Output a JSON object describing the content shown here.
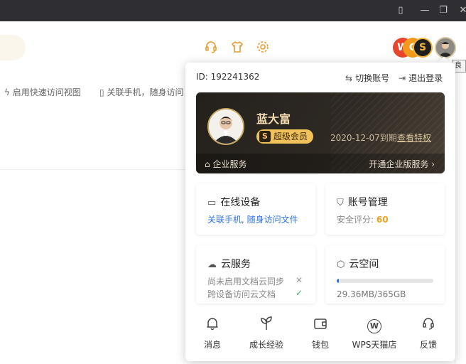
{
  "header": {
    "brand_badges": [
      "W",
      "C",
      "S"
    ],
    "tooltip_stub": "良"
  },
  "background": {
    "link_quick_access": "启用快速访问视图",
    "link_phone": "关联手机，随身访问"
  },
  "account": {
    "id_text": "ID: 192241362",
    "switch_account": "切换账号",
    "logout": "退出登录"
  },
  "member": {
    "name": "蓝大富",
    "vip_label": "超级会员",
    "vip_icon": "S",
    "expire": "2020-12-07到期",
    "view_perks": "查看特权",
    "enterprise_service": "企业服务",
    "open_enterprise": "开通企业版服务"
  },
  "tiles": {
    "online_devices": {
      "title": "在线设备",
      "sub": "关联手机, 随身访问文件",
      "icon": "monitor-icon"
    },
    "account_mgmt": {
      "title": "账号管理",
      "score_label": "安全评分: ",
      "score": "60",
      "icon": "shield-icon"
    },
    "cloud_service": {
      "title": "云服务",
      "row1": "尚未启用文档云同步",
      "row2": "跨设备访问云文档",
      "icon": "cloud-icon"
    },
    "cloud_space": {
      "title": "云空间",
      "usage": "29.36MB/365GB",
      "usage_fraction": 0.02,
      "icon": "cube-icon"
    }
  },
  "bottom_nav": [
    {
      "label": "消息",
      "icon": "bell-icon"
    },
    {
      "label": "成长经验",
      "icon": "sprout-icon"
    },
    {
      "label": "钱包",
      "icon": "wallet-icon"
    },
    {
      "label": "WPS天猫店",
      "icon": "wps-store-icon"
    },
    {
      "label": "反馈",
      "icon": "headset-icon"
    }
  ],
  "colors": {
    "accent_blue": "#2f73e0",
    "gold": "#f1c15a",
    "score_orange": "#f0a020",
    "titlebar": "#2f2f33"
  }
}
